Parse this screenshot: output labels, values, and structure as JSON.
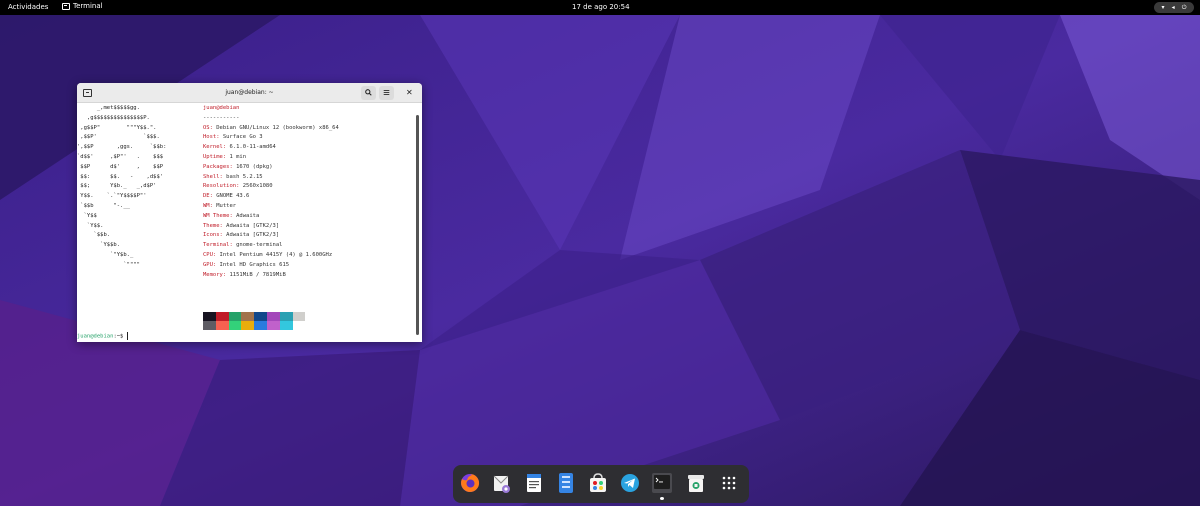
{
  "topbar": {
    "activities_label": "Actividades",
    "app_name": "Terminal",
    "clock": "17 de ago  20:54",
    "status_icons": [
      "wifi-icon",
      "volume-icon",
      "power-icon"
    ]
  },
  "terminal": {
    "title": "juan@debian: ~",
    "logo_lines": [
      "      _,met$$$$$gg.",
      "   ,g$$$$$$$$$$$$$$$P.",
      " ,g$$P\"        \"\"\"Y$$.\".",
      " ,$$P'              `$$$.",
      "',$$P       ,ggs.     `$$b:",
      "`d$$'     ,$P\"'   .    $$$",
      " $$P      d$'     ,    $$P",
      " $$:      $$.   -    ,d$$'",
      " $$;      Y$b._   _,d$P'",
      " Y$$.    `.`\"Y$$$$P\"'",
      " `$$b      \"-.__",
      "  `Y$$",
      "   `Y$$.",
      "     `$$b.",
      "       `Y$$b.",
      "          `\"Y$b._",
      "              `\"\"\"\""
    ],
    "userhost": "juan@debian",
    "separator": "-----------",
    "info": [
      {
        "label": "OS:",
        "value": " Debian GNU/Linux 12 (bookworm) x86_64"
      },
      {
        "label": "Host:",
        "value": " Surface Go 3"
      },
      {
        "label": "Kernel:",
        "value": " 6.1.0-11-amd64"
      },
      {
        "label": "Uptime:",
        "value": " 1 min"
      },
      {
        "label": "Packages:",
        "value": " 1670 (dpkg)"
      },
      {
        "label": "Shell:",
        "value": " bash 5.2.15"
      },
      {
        "label": "Resolution:",
        "value": " 2560x1080"
      },
      {
        "label": "DE:",
        "value": " GNOME 43.6"
      },
      {
        "label": "WM:",
        "value": " Mutter"
      },
      {
        "label": "WM Theme:",
        "value": " Adwaita"
      },
      {
        "label": "Theme:",
        "value": " Adwaita [GTK2/3]"
      },
      {
        "label": "Icons:",
        "value": " Adwaita [GTK2/3]"
      },
      {
        "label": "Terminal:",
        "value": " gnome-terminal"
      },
      {
        "label": "CPU:",
        "value": " Intel Pentium 4415Y (4) @ 1.600GHz"
      },
      {
        "label": "GPU:",
        "value": " Intel HD Graphics 615"
      },
      {
        "label": "Memory:",
        "value": " 1151MiB / 7819MiB"
      }
    ],
    "palette_row1": [
      "#171421",
      "#c01c28",
      "#26a269",
      "#a2734c",
      "#12488b",
      "#a347ba",
      "#2aa1b3",
      "#d0cfcc"
    ],
    "palette_row2": [
      "#5e5c64",
      "#f66151",
      "#33d17a",
      "#e9ad0c",
      "#2a7bde",
      "#c061cb",
      "#33c7de",
      "#ffffff"
    ],
    "prompt_user": "juan@debian",
    "prompt_rest": ":~$ "
  },
  "dock": {
    "items": [
      {
        "name": "firefox-icon",
        "running": false
      },
      {
        "name": "evolution-icon",
        "running": false
      },
      {
        "name": "text-editor-icon",
        "running": false
      },
      {
        "name": "files-icon",
        "running": false
      },
      {
        "name": "software-icon",
        "running": false
      },
      {
        "name": "telegram-icon",
        "running": false
      },
      {
        "name": "terminal-icon",
        "running": true
      },
      {
        "name": "trash-icon",
        "running": false
      },
      {
        "name": "app-grid-icon",
        "running": false
      }
    ]
  },
  "colors": {
    "wallpaper_dark": "#2a1660",
    "wallpaper_mid": "#4a2a9a",
    "wallpaper_light": "#6a46c6",
    "topbar": "#000000",
    "dock": "#2e2e32"
  }
}
